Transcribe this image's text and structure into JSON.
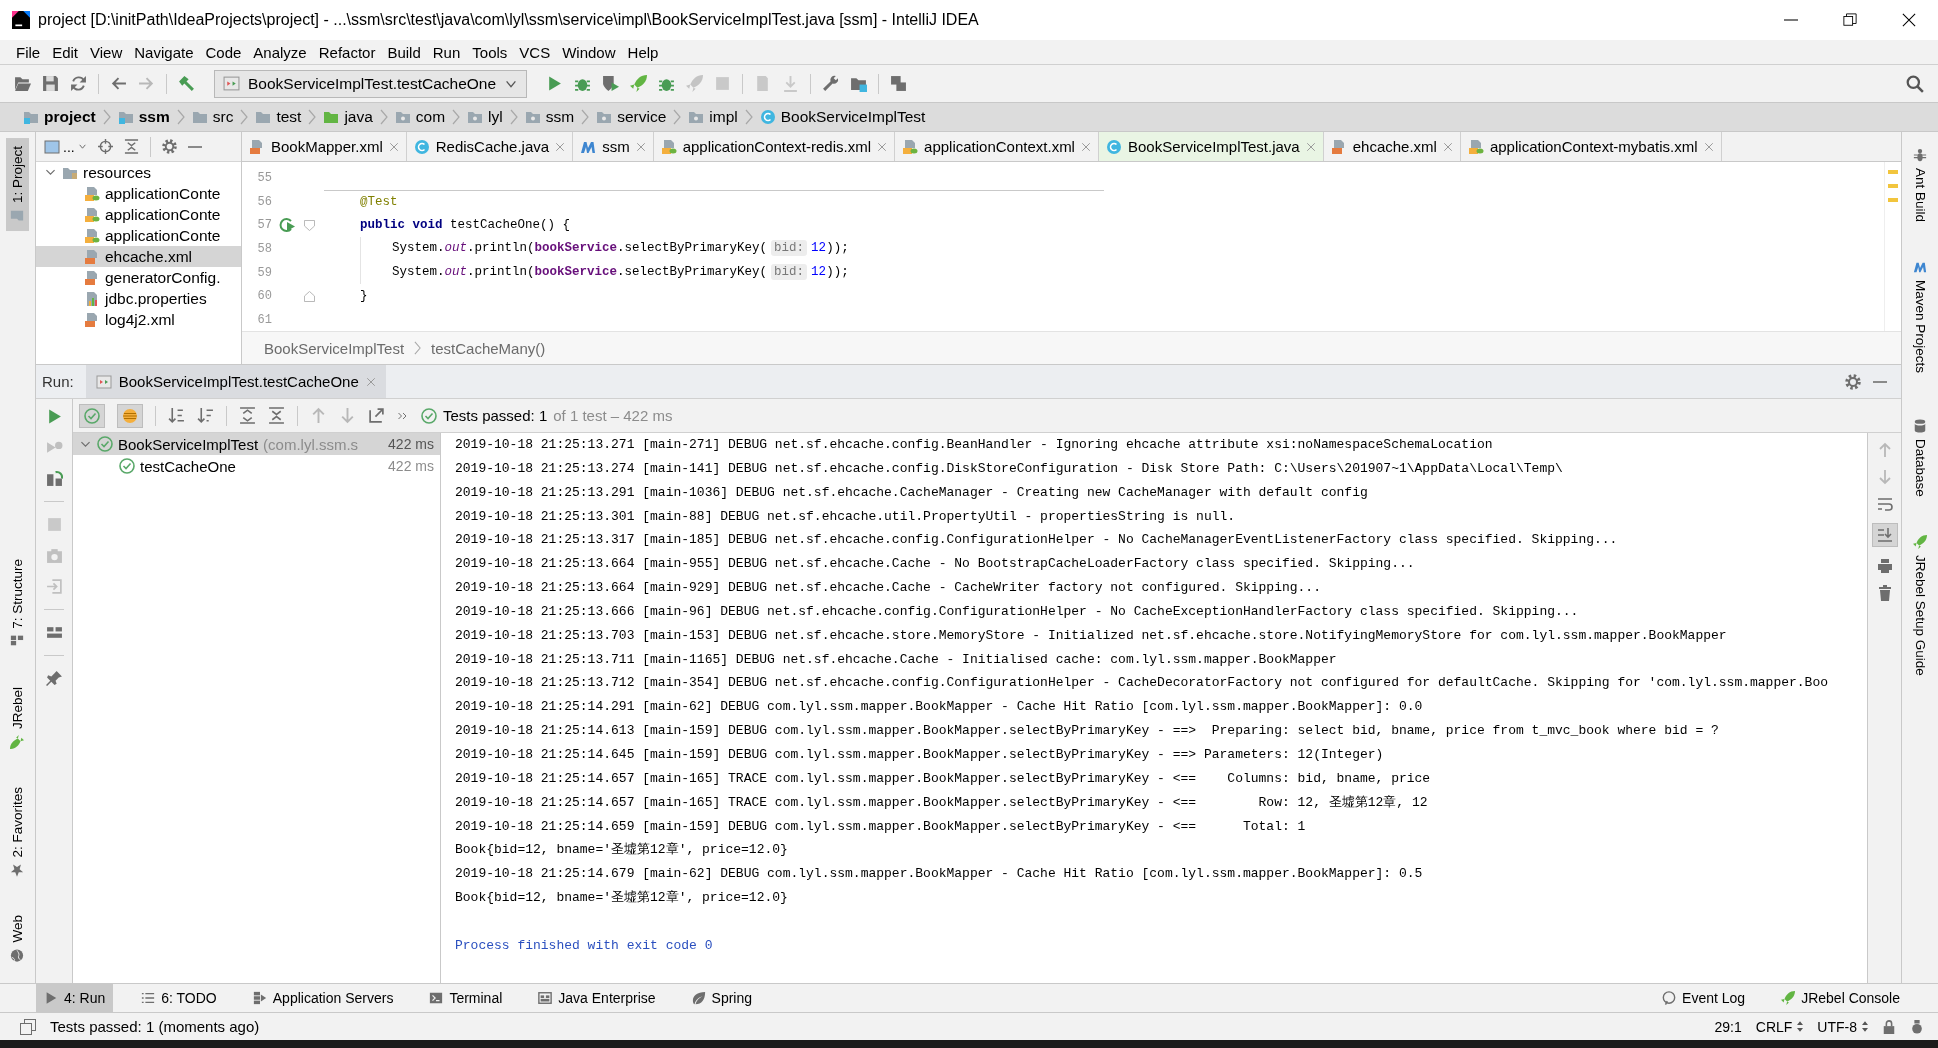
{
  "window": {
    "title": "project [D:\\initPath\\IdeaProjects\\project] - ...\\ssm\\src\\test\\java\\com\\lyl\\ssm\\service\\impl\\BookServiceImplTest.java [ssm] - IntelliJ IDEA"
  },
  "menu_bar": {
    "items": [
      "File",
      "Edit",
      "View",
      "Navigate",
      "Code",
      "Analyze",
      "Refactor",
      "Build",
      "Run",
      "Tools",
      "VCS",
      "Window",
      "Help"
    ]
  },
  "toolbar": {
    "run_configuration": "BookServiceImplTest.testCacheOne"
  },
  "navigation_bar": {
    "items": [
      {
        "label": "project",
        "kind": "project"
      },
      {
        "label": "ssm",
        "kind": "module"
      },
      {
        "label": "src",
        "kind": "folder"
      },
      {
        "label": "test",
        "kind": "folder"
      },
      {
        "label": "java",
        "kind": "source"
      },
      {
        "label": "com",
        "kind": "package"
      },
      {
        "label": "lyl",
        "kind": "package"
      },
      {
        "label": "ssm",
        "kind": "package"
      },
      {
        "label": "service",
        "kind": "package"
      },
      {
        "label": "impl",
        "kind": "package"
      },
      {
        "label": "BookServiceImplTest",
        "kind": "class"
      }
    ]
  },
  "left_tool_stripe": [
    {
      "label": "1: Project",
      "kind": "project",
      "selected": true
    },
    {
      "label": "7: Structure",
      "kind": "structure",
      "selected": false
    },
    {
      "label": "JRebel",
      "kind": "jrebel",
      "selected": false
    },
    {
      "label": "2: Favorites",
      "kind": "favorites",
      "selected": false
    },
    {
      "label": "Web",
      "kind": "web",
      "selected": false
    }
  ],
  "right_tool_stripe": [
    {
      "label": "Ant Build",
      "kind": "ant"
    },
    {
      "label": "Maven Projects",
      "kind": "maven"
    },
    {
      "label": "Database",
      "kind": "database"
    },
    {
      "label": "JRebel Setup Guide",
      "kind": "jrebel"
    }
  ],
  "project_panel": {
    "view_selector": "...",
    "tree": [
      {
        "label": "resources",
        "kind": "resources",
        "expanded": true,
        "selected": false,
        "children": [
          {
            "label": "applicationConte",
            "kind": "spring",
            "selected": false
          },
          {
            "label": "applicationConte",
            "kind": "spring",
            "selected": false
          },
          {
            "label": "applicationConte",
            "kind": "spring",
            "selected": false
          },
          {
            "label": "ehcache.xml",
            "kind": "xml",
            "selected": true
          },
          {
            "label": "generatorConfig.",
            "kind": "xml",
            "selected": false
          },
          {
            "label": "jdbc.properties",
            "kind": "properties",
            "selected": false
          },
          {
            "label": "log4j2.xml",
            "kind": "xml",
            "selected": false
          }
        ]
      }
    ]
  },
  "editor": {
    "tabs": [
      {
        "label": "BookMapper.xml",
        "kind": "xml",
        "selected": false
      },
      {
        "label": "RedisCache.java",
        "kind": "class",
        "selected": false
      },
      {
        "label": "ssm",
        "kind": "maven",
        "selected": false
      },
      {
        "label": "applicationContext-redis.xml",
        "kind": "spring",
        "selected": false
      },
      {
        "label": "applicationContext.xml",
        "kind": "spring",
        "selected": false
      },
      {
        "label": "BookServiceImplTest.java",
        "kind": "class",
        "selected": true
      },
      {
        "label": "ehcache.xml",
        "kind": "xml",
        "selected": false
      },
      {
        "label": "applicationContext-mybatis.xml",
        "kind": "spring",
        "selected": false
      }
    ],
    "lines": [
      {
        "number": "55"
      },
      {
        "number": "56",
        "separator_above": true,
        "segments": [
          {
            "kind": "annotation",
            "text": "@Test"
          }
        ]
      },
      {
        "number": "57",
        "run_marker": true,
        "fold_start": true,
        "segments": [
          {
            "kind": "keyword",
            "text": "public void "
          },
          {
            "kind": "plain",
            "text": "testCacheOne() {"
          }
        ]
      },
      {
        "number": "58",
        "indented": true,
        "segments": [
          {
            "kind": "plain",
            "text": "System."
          },
          {
            "kind": "static",
            "text": "out"
          },
          {
            "kind": "plain",
            "text": ".println("
          },
          {
            "kind": "field",
            "text": "bookService"
          },
          {
            "kind": "plain",
            "text": ".selectByPrimaryKey("
          },
          {
            "kind": "hint",
            "text": "bid:"
          },
          {
            "kind": "number",
            "text": "12"
          },
          {
            "kind": "plain",
            "text": "));"
          }
        ]
      },
      {
        "number": "59",
        "indented": true,
        "segments": [
          {
            "kind": "plain",
            "text": "System."
          },
          {
            "kind": "static",
            "text": "out"
          },
          {
            "kind": "plain",
            "text": ".println("
          },
          {
            "kind": "field",
            "text": "bookService"
          },
          {
            "kind": "plain",
            "text": ".selectByPrimaryKey("
          },
          {
            "kind": "hint",
            "text": "bid:"
          },
          {
            "kind": "number",
            "text": "12"
          },
          {
            "kind": "plain",
            "text": "));"
          }
        ]
      },
      {
        "number": "60",
        "fold_end": true,
        "segments": [
          {
            "kind": "plain",
            "text": "}"
          }
        ]
      },
      {
        "number": "61"
      }
    ],
    "breadcrumb": [
      "BookServiceImplTest",
      "testCacheMany()"
    ]
  },
  "run_panel": {
    "title": "Run:",
    "tabs": [
      {
        "label": "BookServiceImplTest.testCacheOne",
        "selected": true
      }
    ],
    "filters": [
      {
        "kind": "passed",
        "on": true
      },
      {
        "kind": "ignored",
        "on": true
      }
    ],
    "summary": {
      "status": "Tests passed: 1",
      "detail": "of 1 test – 422 ms"
    },
    "test_tree": [
      {
        "label": "BookServiceImplTest",
        "detail": "(com.lyl.ssm.s",
        "time": "422 ms",
        "passed": true,
        "expanded": true,
        "selected": true,
        "children": [
          {
            "label": "testCacheOne",
            "time": "422 ms",
            "passed": true,
            "selected": false
          }
        ]
      }
    ],
    "scroll_to_end": true,
    "console": [
      {
        "kind": "log",
        "text": "2019-10-18 21:25:13.271 [main-271] DEBUG net.sf.ehcache.config.BeanHandler - Ignoring ehcache attribute xsi:noNamespaceSchemaLocation"
      },
      {
        "kind": "log",
        "text": "2019-10-18 21:25:13.274 [main-141] DEBUG net.sf.ehcache.config.DiskStoreConfiguration - Disk Store Path: C:\\Users\\201907~1\\AppData\\Local\\Temp\\"
      },
      {
        "kind": "log",
        "text": "2019-10-18 21:25:13.291 [main-1036] DEBUG net.sf.ehcache.CacheManager - Creating new CacheManager with default config"
      },
      {
        "kind": "log",
        "text": "2019-10-18 21:25:13.301 [main-88] DEBUG net.sf.ehcache.util.PropertyUtil - propertiesString is null."
      },
      {
        "kind": "log",
        "text": "2019-10-18 21:25:13.317 [main-185] DEBUG net.sf.ehcache.config.ConfigurationHelper - No CacheManagerEventListenerFactory class specified. Skipping..."
      },
      {
        "kind": "log",
        "text": "2019-10-18 21:25:13.664 [main-955] DEBUG net.sf.ehcache.Cache - No BootstrapCacheLoaderFactory class specified. Skipping..."
      },
      {
        "kind": "log",
        "text": "2019-10-18 21:25:13.664 [main-929] DEBUG net.sf.ehcache.Cache - CacheWriter factory not configured. Skipping..."
      },
      {
        "kind": "log",
        "text": "2019-10-18 21:25:13.666 [main-96] DEBUG net.sf.ehcache.config.ConfigurationHelper - No CacheExceptionHandlerFactory class specified. Skipping..."
      },
      {
        "kind": "log",
        "text": "2019-10-18 21:25:13.703 [main-153] DEBUG net.sf.ehcache.store.MemoryStore - Initialized net.sf.ehcache.store.NotifyingMemoryStore for com.lyl.ssm.mapper.BookMapper"
      },
      {
        "kind": "log",
        "text": "2019-10-18 21:25:13.711 [main-1165] DEBUG net.sf.ehcache.Cache - Initialised cache: com.lyl.ssm.mapper.BookMapper"
      },
      {
        "kind": "log",
        "text": "2019-10-18 21:25:13.712 [main-354] DEBUG net.sf.ehcache.config.ConfigurationHelper - CacheDecoratorFactory not configured for defaultCache. Skipping for 'com.lyl.ssm.mapper.Boo"
      },
      {
        "kind": "log",
        "text": "2019-10-18 21:25:14.291 [main-62] DEBUG com.lyl.ssm.mapper.BookMapper - Cache Hit Ratio [com.lyl.ssm.mapper.BookMapper]: 0.0"
      },
      {
        "kind": "log",
        "text": "2019-10-18 21:25:14.613 [main-159] DEBUG com.lyl.ssm.mapper.BookMapper.selectByPrimaryKey - ==>  Preparing: select bid, bname, price from t_mvc_book where bid = ?"
      },
      {
        "kind": "log",
        "text": "2019-10-18 21:25:14.645 [main-159] DEBUG com.lyl.ssm.mapper.BookMapper.selectByPrimaryKey - ==> Parameters: 12(Integer)"
      },
      {
        "kind": "log",
        "text": "2019-10-18 21:25:14.657 [main-165] TRACE com.lyl.ssm.mapper.BookMapper.selectByPrimaryKey - <==    Columns: bid, bname, price"
      },
      {
        "kind": "log",
        "text": "2019-10-18 21:25:14.657 [main-165] TRACE com.lyl.ssm.mapper.BookMapper.selectByPrimaryKey - <==        Row: 12, 圣墟第12章, 12"
      },
      {
        "kind": "log",
        "text": "2019-10-18 21:25:14.659 [main-159] DEBUG com.lyl.ssm.mapper.BookMapper.selectByPrimaryKey - <==      Total: 1"
      },
      {
        "kind": "log",
        "text": "Book{bid=12, bname='圣墟第12章', price=12.0}"
      },
      {
        "kind": "log",
        "text": "2019-10-18 21:25:14.679 [main-62] DEBUG com.lyl.ssm.mapper.BookMapper - Cache Hit Ratio [com.lyl.ssm.mapper.BookMapper]: 0.5"
      },
      {
        "kind": "log",
        "text": "Book{bid=12, bname='圣墟第12章', price=12.0}"
      },
      {
        "kind": "exit",
        "text": "Process finished with exit code 0"
      }
    ]
  },
  "tool_window_bar": {
    "left": [
      {
        "label": "4: Run",
        "kind": "run",
        "selected": true
      },
      {
        "label": "6: TODO",
        "kind": "todo",
        "selected": false
      },
      {
        "label": "Application Servers",
        "kind": "servers",
        "selected": false
      },
      {
        "label": "Terminal",
        "kind": "terminal",
        "selected": false
      },
      {
        "label": "Java Enterprise",
        "kind": "enterprise",
        "selected": false
      },
      {
        "label": "Spring",
        "kind": "spring",
        "selected": false
      }
    ],
    "right": [
      {
        "label": "Event Log",
        "kind": "event-log",
        "selected": false
      },
      {
        "label": "JRebel Console",
        "kind": "jrebel",
        "selected": false
      }
    ]
  },
  "status_bar": {
    "message": "Tests passed: 1 (moments ago)",
    "position": "29:1",
    "line_separator": "CRLF",
    "encoding": "UTF-8"
  }
}
